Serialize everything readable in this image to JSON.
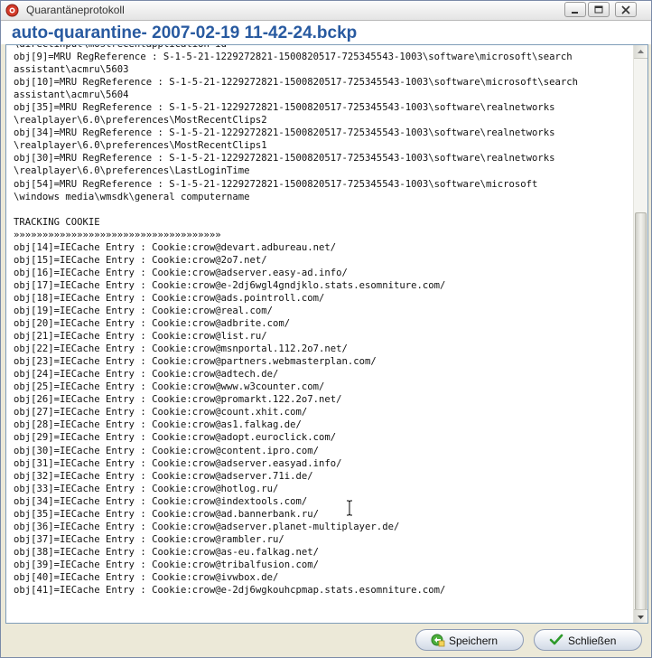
{
  "window": {
    "title": "Quarantäneprotokoll"
  },
  "header": {
    "document_title": "auto-quarantine- 2007-02-19 11-42-24.bckp"
  },
  "log": {
    "lines": [
      "\\directinput\\mostrecentapplication id",
      "obj[9]=MRU RegReference : S-1-5-21-1229272821-1500820517-725345543-1003\\software\\microsoft\\search",
      "assistant\\acmru\\5603",
      "obj[10]=MRU RegReference : S-1-5-21-1229272821-1500820517-725345543-1003\\software\\microsoft\\search",
      "assistant\\acmru\\5604",
      "obj[35]=MRU RegReference : S-1-5-21-1229272821-1500820517-725345543-1003\\software\\realnetworks",
      "\\realplayer\\6.0\\preferences\\MostRecentClips2",
      "obj[34]=MRU RegReference : S-1-5-21-1229272821-1500820517-725345543-1003\\software\\realnetworks",
      "\\realplayer\\6.0\\preferences\\MostRecentClips1",
      "obj[30]=MRU RegReference : S-1-5-21-1229272821-1500820517-725345543-1003\\software\\realnetworks",
      "\\realplayer\\6.0\\preferences\\LastLoginTime",
      "obj[54]=MRU RegReference : S-1-5-21-1229272821-1500820517-725345543-1003\\software\\microsoft",
      "\\windows media\\wmsdk\\general computername",
      "",
      "TRACKING COOKIE",
      "»»»»»»»»»»»»»»»»»»»»»»»»»»»»»»»»»»»»",
      "obj[14]=IECache Entry : Cookie:crow@devart.adbureau.net/",
      "obj[15]=IECache Entry : Cookie:crow@2o7.net/",
      "obj[16]=IECache Entry : Cookie:crow@adserver.easy-ad.info/",
      "obj[17]=IECache Entry : Cookie:crow@e-2dj6wgl4gndjklo.stats.esomniture.com/",
      "obj[18]=IECache Entry : Cookie:crow@ads.pointroll.com/",
      "obj[19]=IECache Entry : Cookie:crow@real.com/",
      "obj[20]=IECache Entry : Cookie:crow@adbrite.com/",
      "obj[21]=IECache Entry : Cookie:crow@list.ru/",
      "obj[22]=IECache Entry : Cookie:crow@msnportal.112.2o7.net/",
      "obj[23]=IECache Entry : Cookie:crow@partners.webmasterplan.com/",
      "obj[24]=IECache Entry : Cookie:crow@adtech.de/",
      "obj[25]=IECache Entry : Cookie:crow@www.w3counter.com/",
      "obj[26]=IECache Entry : Cookie:crow@promarkt.122.2o7.net/",
      "obj[27]=IECache Entry : Cookie:crow@count.xhit.com/",
      "obj[28]=IECache Entry : Cookie:crow@as1.falkag.de/",
      "obj[29]=IECache Entry : Cookie:crow@adopt.euroclick.com/",
      "obj[30]=IECache Entry : Cookie:crow@content.ipro.com/",
      "obj[31]=IECache Entry : Cookie:crow@adserver.easyad.info/",
      "obj[32]=IECache Entry : Cookie:crow@adserver.71i.de/",
      "obj[33]=IECache Entry : Cookie:crow@hotlog.ru/",
      "obj[34]=IECache Entry : Cookie:crow@indextools.com/",
      "obj[35]=IECache Entry : Cookie:crow@ad.bannerbank.ru/",
      "obj[36]=IECache Entry : Cookie:crow@adserver.planet-multiplayer.de/",
      "obj[37]=IECache Entry : Cookie:crow@rambler.ru/",
      "obj[38]=IECache Entry : Cookie:crow@as-eu.falkag.net/",
      "obj[39]=IECache Entry : Cookie:crow@tribalfusion.com/",
      "obj[40]=IECache Entry : Cookie:crow@ivwbox.de/",
      "obj[41]=IECache Entry : Cookie:crow@e-2dj6wgkouhcpmap.stats.esomniture.com/"
    ]
  },
  "buttons": {
    "save_label": "Speichern",
    "close_label": "Schließen"
  },
  "icons": {
    "app": "quarantine-icon",
    "save": "save-icon",
    "close": "checkmark-icon"
  },
  "colors": {
    "title_accent": "#285aa0"
  }
}
